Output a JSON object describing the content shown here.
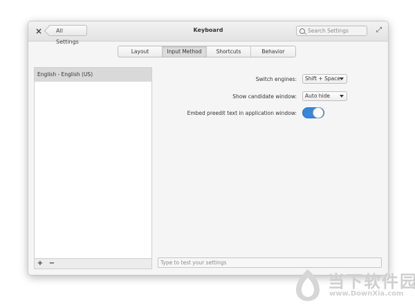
{
  "window": {
    "title": "Keyboard",
    "back_label": "All Settings",
    "close_glyph": "×",
    "maximize_glyph": "⤢",
    "search": {
      "placeholder": "Search Settings"
    }
  },
  "tabs": [
    {
      "label": "Layout"
    },
    {
      "label": "Input Method",
      "active": true
    },
    {
      "label": "Shortcuts"
    },
    {
      "label": "Behavior"
    }
  ],
  "sidebar": {
    "items": [
      {
        "label": "English - English (US)",
        "selected": true
      }
    ],
    "add_glyph": "+",
    "remove_glyph": "−"
  },
  "settings": {
    "switch_engines": {
      "label": "Switch engines:",
      "value": "Shift + Space"
    },
    "candidate_window": {
      "label": "Show candidate window:",
      "value": "Auto hide"
    },
    "embed_preedit": {
      "label": "Embed preedit text in application window:",
      "on": true
    }
  },
  "test_field": {
    "placeholder": "Type to test your settings"
  },
  "watermark": {
    "text_cn": "当下软件园",
    "text_en": "www.DownXia.com"
  },
  "colors": {
    "accent": "#3a86d8",
    "selection": "#d9d9d9"
  },
  "icons": {
    "search": "search-icon",
    "close": "close-icon",
    "maximize": "maximize-icon",
    "dropdown": "chevron-down-icon"
  }
}
